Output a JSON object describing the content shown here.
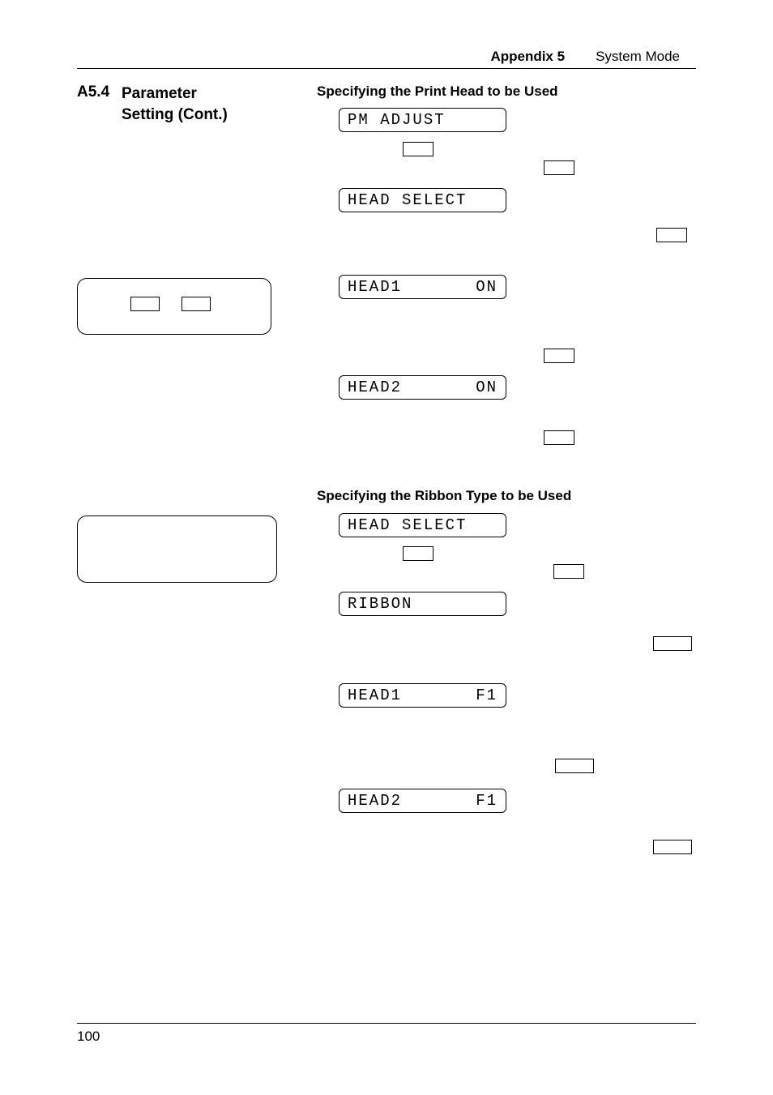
{
  "header": {
    "appendix": "Appendix 5",
    "chapter": "System Mode"
  },
  "section": {
    "number": "A5.4",
    "title_line1": "Parameter",
    "title_line2": "Setting (Cont.)"
  },
  "block1": {
    "heading": "Specifying the Print Head to be Used",
    "lcd1": "PM ADJUST",
    "lcd2": "HEAD SELECT",
    "lcd3_left": "HEAD1",
    "lcd3_right": "ON",
    "lcd4_left": "HEAD2",
    "lcd4_right": "ON"
  },
  "block2": {
    "heading": "Specifying the Ribbon Type to be Used",
    "lcd1": "HEAD SELECT",
    "lcd2": "RIBBON",
    "lcd3_left": "HEAD1",
    "lcd3_right": "F1",
    "lcd4_left": "HEAD2",
    "lcd4_right": "F1"
  },
  "footer": {
    "page": "100"
  }
}
